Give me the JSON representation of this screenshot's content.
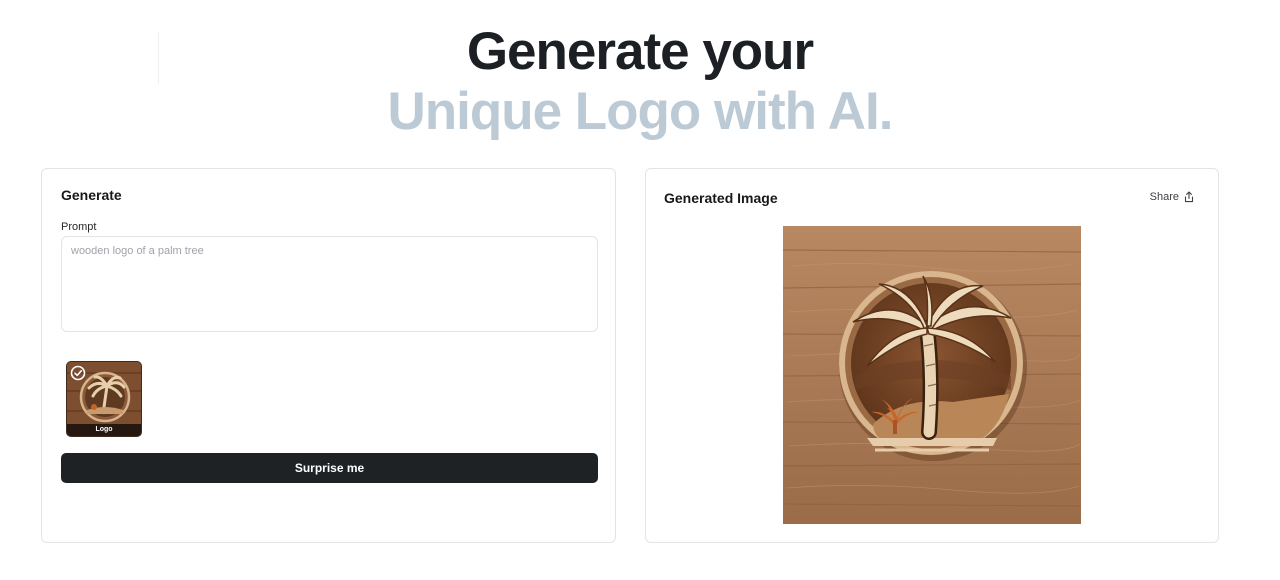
{
  "hero": {
    "line1": "Generate your",
    "line2": "Unique Logo with AI."
  },
  "generate_panel": {
    "title": "Generate",
    "prompt_label": "Prompt",
    "prompt_placeholder": "wooden logo of a palm tree",
    "style_option": {
      "label": "Logo",
      "selected": true,
      "icon": "check-circle-icon"
    },
    "surprise_label": "Surprise me"
  },
  "result_panel": {
    "title": "Generated Image",
    "share_label": "Share",
    "share_icon": "share-icon"
  },
  "colors": {
    "hero_dark": "#1c1f23",
    "hero_muted": "#bccad5",
    "button_bg": "#1f2225",
    "border": "#e4e4e7"
  }
}
